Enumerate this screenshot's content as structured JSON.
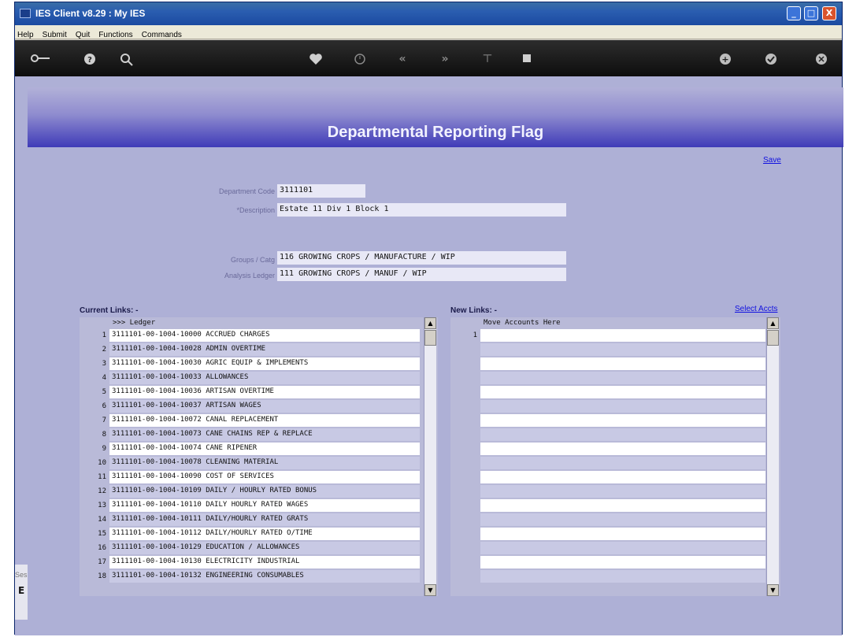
{
  "window": {
    "title": "IES Client v8.29 : My IES",
    "controls": [
      "_",
      "□",
      "X"
    ]
  },
  "menu": [
    "Help",
    "Submit",
    "Quit",
    "Functions",
    "Commands"
  ],
  "toolbar_icons": [
    "key-icon",
    "help-icon",
    "search-icon",
    "heart-icon",
    "clock-icon",
    "rewind-icon",
    "forward-icon",
    "tree-icon",
    "stop-icon",
    "plus-icon",
    "check-icon",
    "close-icon"
  ],
  "page": {
    "title": "Departmental Reporting Flag",
    "save_label": "Save"
  },
  "form": {
    "dept_code_label": "Department Code",
    "dept_code_value": "3111101",
    "description_label": "*Description",
    "description_value": "Estate 11 Div 1 Block 1",
    "groups_label": "Groups / Catg",
    "groups_value": "116 GROWING CROPS / MANUFACTURE / WIP",
    "analysis_label": "Analysis Ledger",
    "analysis_value": "111 GROWING CROPS / MANUF / WIP"
  },
  "current_links": {
    "heading": "Current Links: -",
    "column_header": ">>> Ledger",
    "rows": [
      {
        "n": "1",
        "text": "3111101-00-1004-10000 ACCRUED CHARGES"
      },
      {
        "n": "2",
        "text": "3111101-00-1004-10028 ADMIN OVERTIME"
      },
      {
        "n": "3",
        "text": "3111101-00-1004-10030 AGRIC EQUIP & IMPLEMENTS"
      },
      {
        "n": "4",
        "text": "3111101-00-1004-10033 ALLOWANCES"
      },
      {
        "n": "5",
        "text": "3111101-00-1004-10036 ARTISAN OVERTIME"
      },
      {
        "n": "6",
        "text": "3111101-00-1004-10037 ARTISAN WAGES"
      },
      {
        "n": "7",
        "text": "3111101-00-1004-10072 CANAL REPLACEMENT"
      },
      {
        "n": "8",
        "text": "3111101-00-1004-10073 CANE CHAINS REP & REPLACE"
      },
      {
        "n": "9",
        "text": "3111101-00-1004-10074 CANE RIPENER"
      },
      {
        "n": "10",
        "text": "3111101-00-1004-10078 CLEANING MATERIAL"
      },
      {
        "n": "11",
        "text": "3111101-00-1004-10090 COST OF SERVICES"
      },
      {
        "n": "12",
        "text": "3111101-00-1004-10109 DAILY / HOURLY RATED BONUS"
      },
      {
        "n": "13",
        "text": "3111101-00-1004-10110 DAILY HOURLY RATED WAGES"
      },
      {
        "n": "14",
        "text": "3111101-00-1004-10111 DAILY/HOURLY RATED GRATS"
      },
      {
        "n": "15",
        "text": "3111101-00-1004-10112 DAILY/HOURLY RATED O/TIME"
      },
      {
        "n": "16",
        "text": "3111101-00-1004-10129 EDUCATION / ALLOWANCES"
      },
      {
        "n": "17",
        "text": "3111101-00-1004-10130 ELECTRICITY INDUSTRIAL"
      },
      {
        "n": "18",
        "text": "3111101-00-1004-10132 ENGINEERING CONSUMABLES"
      }
    ]
  },
  "new_links": {
    "heading": "New Links: -",
    "select_label": "Select Accts",
    "column_header": "Move Accounts Here",
    "first_row_number": "1"
  },
  "left_stub": {
    "text": "Ses",
    "glyph": "E"
  }
}
